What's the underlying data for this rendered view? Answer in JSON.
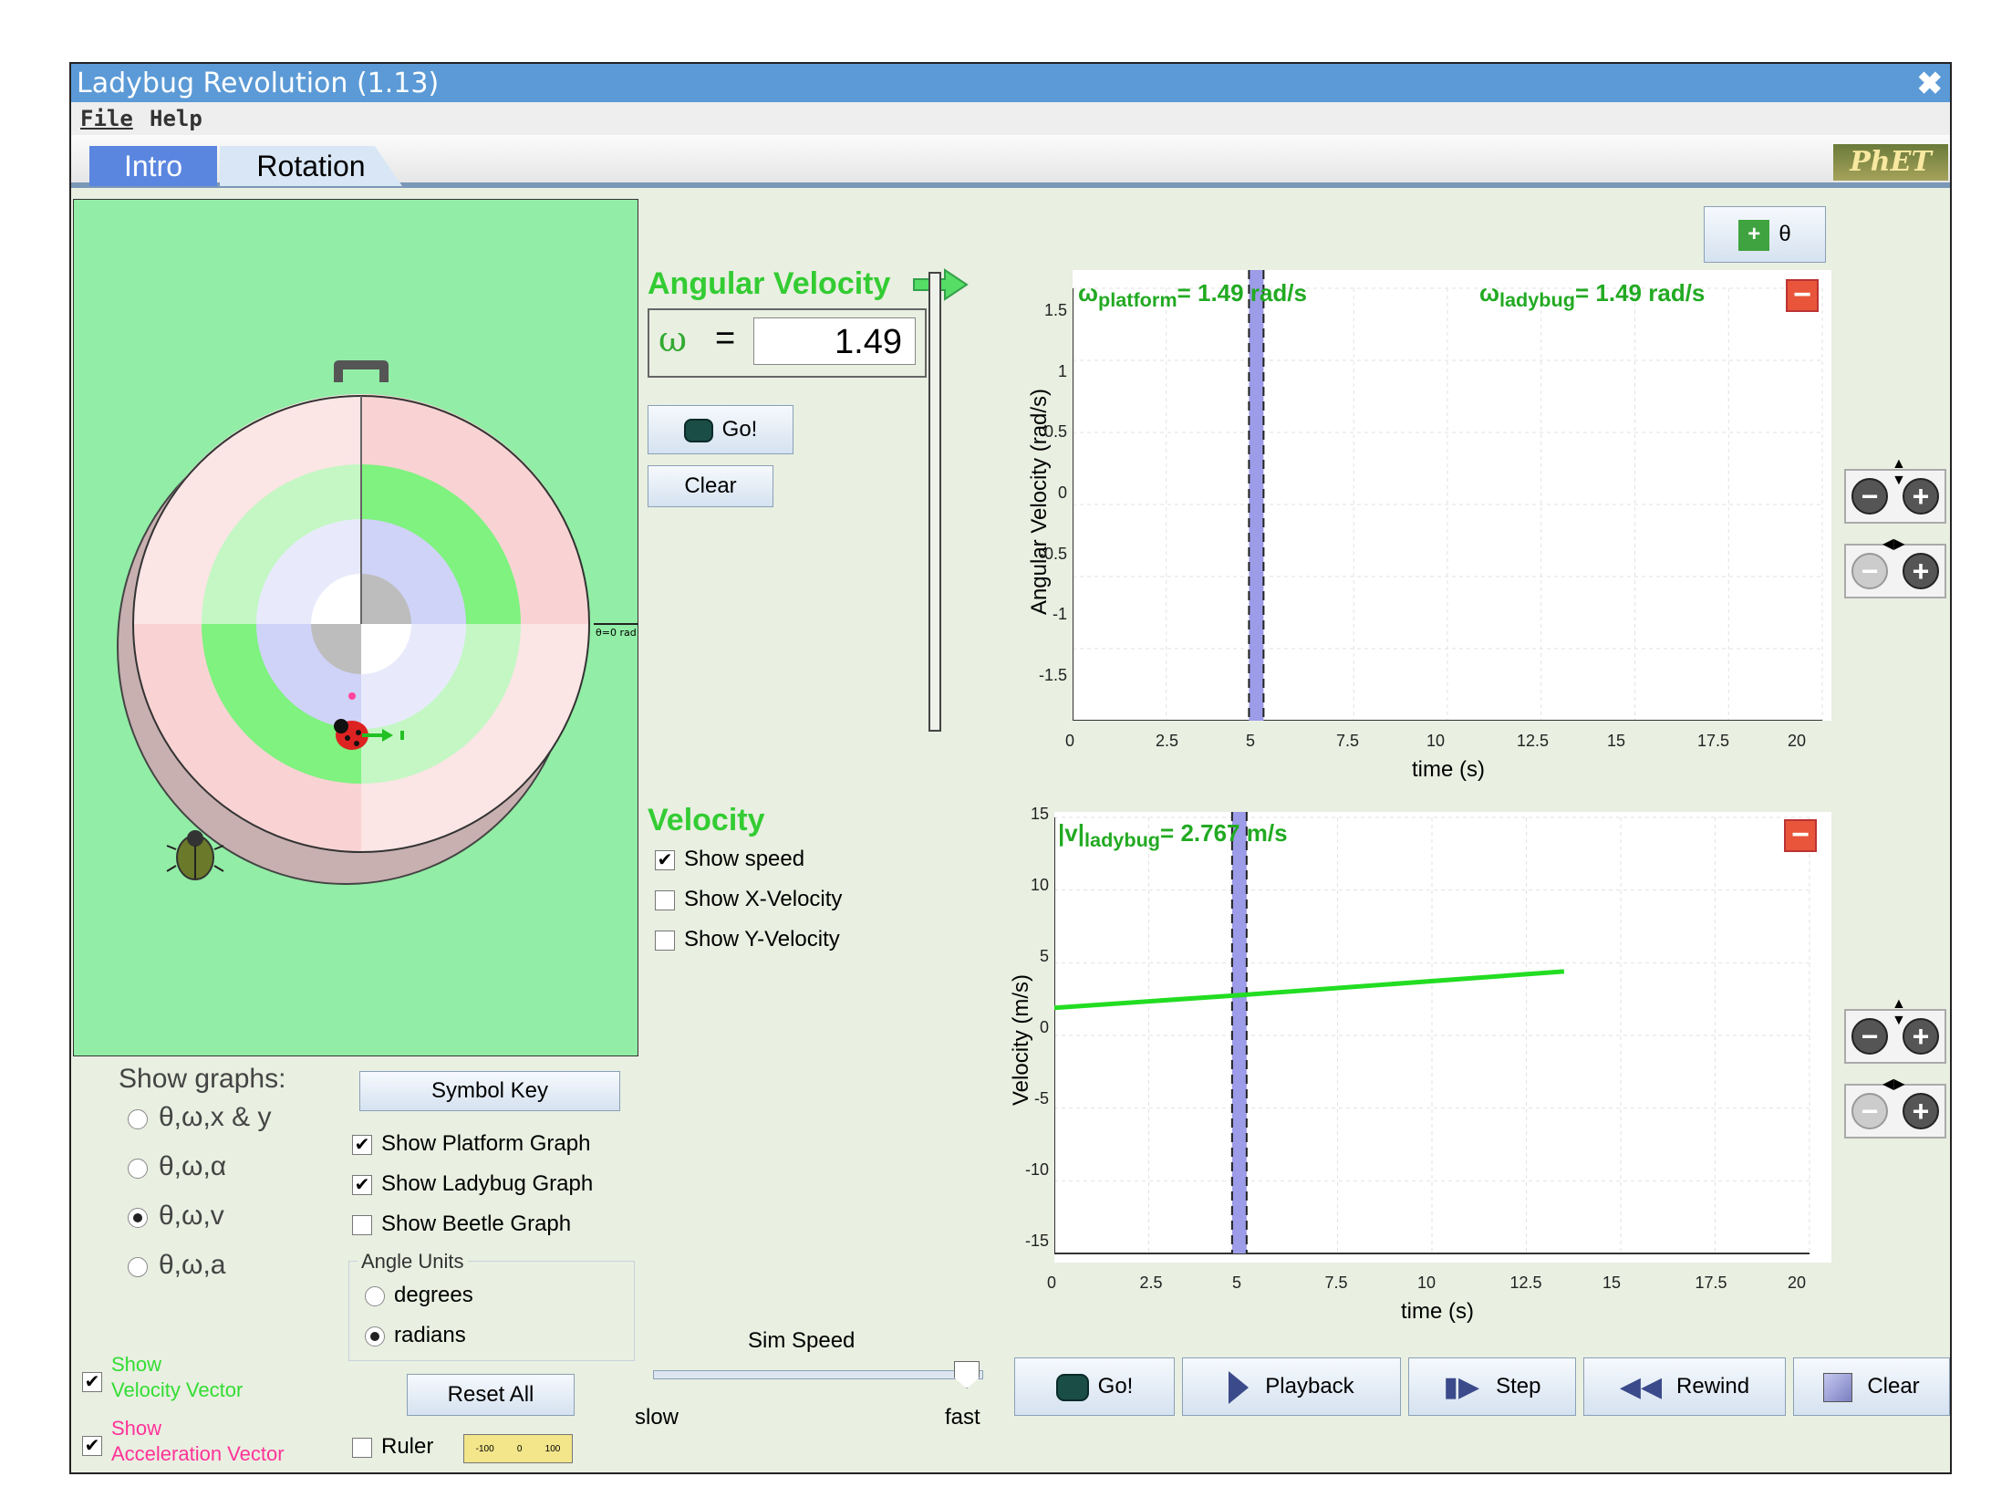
{
  "window": {
    "title": "Ladybug Revolution (1.13)",
    "close": "✖"
  },
  "menu": {
    "file": "File",
    "help": "Help"
  },
  "tabs": {
    "intro": "Intro",
    "rotation": "Rotation"
  },
  "logo": "PhET",
  "platform": {
    "angle_label": "θ=0 rad"
  },
  "show_graphs": {
    "heading": "Show graphs:",
    "options": [
      "θ,ω,x & y",
      "θ,ω,α",
      "θ,ω,v",
      "θ,ω,a"
    ],
    "selected_index": 2
  },
  "symbol_key": "Symbol Key",
  "checks": {
    "platform": "Show Platform Graph",
    "ladybug": "Show Ladybug Graph",
    "beetle": "Show Beetle Graph"
  },
  "angle_units": {
    "legend": "Angle Units",
    "degrees": "degrees",
    "radians": "radians"
  },
  "reset_all": "Reset All",
  "ruler": {
    "label": "Ruler",
    "ticks": [
      "-100",
      "0",
      "100"
    ]
  },
  "vectors": {
    "velocity": {
      "line1": "Show",
      "line2": "Velocity Vector",
      "color": "#33dd33"
    },
    "acceleration": {
      "line1": "Show",
      "line2": "Acceleration Vector",
      "color": "#ff3399"
    }
  },
  "sim_speed": {
    "title": "Sim Speed",
    "slow": "slow",
    "fast": "fast"
  },
  "angular_panel": {
    "title": "Angular Velocity",
    "symbol": "ω",
    "equals": "=",
    "value": "1.49",
    "go": "Go!",
    "clear": "Clear"
  },
  "velocity_panel": {
    "title": "Velocity",
    "show_speed": "Show speed",
    "show_x": "Show X-Velocity",
    "show_y": "Show Y-Velocity"
  },
  "theta_button": "θ",
  "graph1": {
    "ylabel": "Angular Velocity (rad/s)",
    "xlabel": "time (s)",
    "yticks": [
      "1.5",
      "1",
      "0.5",
      "0",
      "-0.5",
      "-1",
      "-1.5"
    ],
    "xticks": [
      "0",
      "2.5",
      "5",
      "7.5",
      "10",
      "12.5",
      "15",
      "17.5",
      "20"
    ],
    "readout_platform_sym": "ω",
    "readout_platform_sub": "platform",
    "readout_platform_val": "= 1.49 rad/s",
    "readout_ladybug_sym": "ω",
    "readout_ladybug_sub": "ladybug",
    "readout_ladybug_val": "= 1.49 rad/s"
  },
  "graph2": {
    "ylabel": "Velocity (m/s)",
    "xlabel": "time (s)",
    "yticks": [
      "15",
      "10",
      "5",
      "0",
      "-5",
      "-10",
      "-15"
    ],
    "xticks": [
      "0",
      "2.5",
      "5",
      "7.5",
      "10",
      "12.5",
      "15",
      "17.5",
      "20"
    ],
    "readout_sym": "|v|",
    "readout_sub": "ladybug",
    "readout_val": "= 2.767 m/s"
  },
  "chart_data": [
    {
      "type": "line",
      "ylabel": "Angular Velocity (rad/s)",
      "xlabel": "time (s)",
      "xlim": [
        0,
        20
      ],
      "ylim": [
        -1.5,
        1.5
      ],
      "cursor_time": 4.9,
      "series": []
    },
    {
      "type": "line",
      "ylabel": "Velocity (m/s)",
      "xlabel": "time (s)",
      "xlim": [
        0,
        20
      ],
      "ylim": [
        -15,
        15
      ],
      "cursor_time": 4.9,
      "series": [
        {
          "name": "|v| ladybug",
          "color": "#22dd22",
          "x": [
            0,
            4.9,
            13.5
          ],
          "y": [
            1.9,
            2.77,
            4.4
          ]
        }
      ]
    }
  ],
  "controls": {
    "go": "Go!",
    "playback": "Playback",
    "step": "Step",
    "rewind": "Rewind",
    "clear": "Clear"
  }
}
